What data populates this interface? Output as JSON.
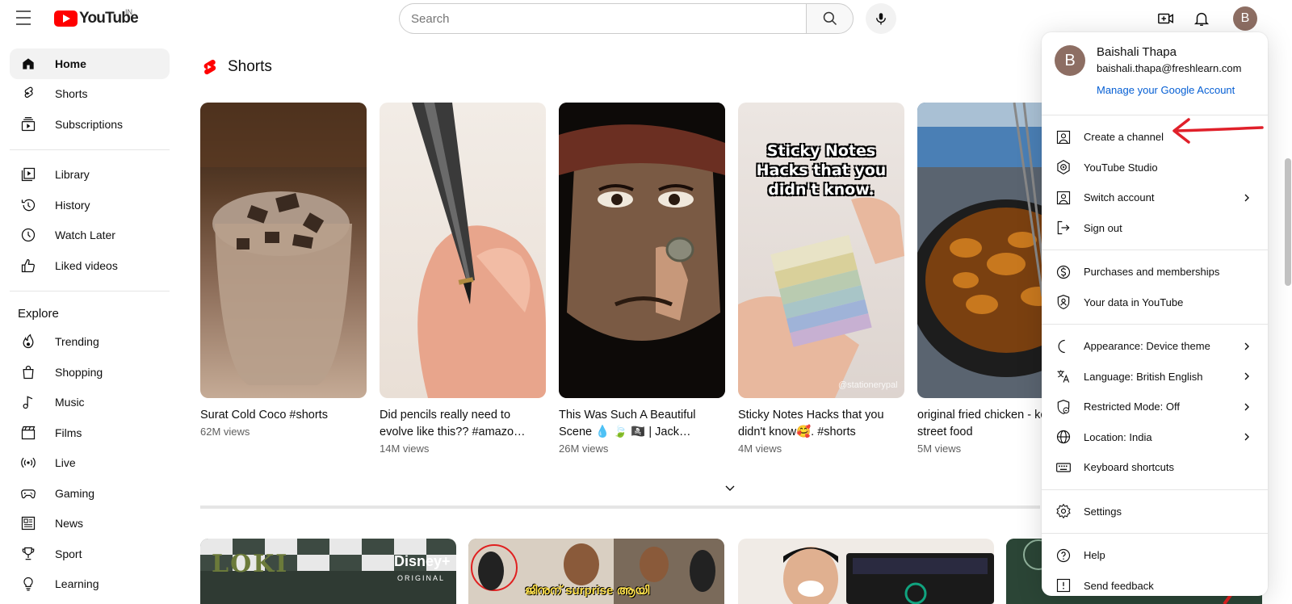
{
  "header": {
    "logo_text": "YouTube",
    "country_code": "IN",
    "search_placeholder": "Search"
  },
  "sidebar": {
    "primary": [
      {
        "label": "Home",
        "icon": "home-icon",
        "active": true
      },
      {
        "label": "Shorts",
        "icon": "shorts-icon"
      },
      {
        "label": "Subscriptions",
        "icon": "subscriptions-icon"
      }
    ],
    "library": [
      {
        "label": "Library",
        "icon": "library-icon"
      },
      {
        "label": "History",
        "icon": "history-icon"
      },
      {
        "label": "Watch Later",
        "icon": "watch-later-icon"
      },
      {
        "label": "Liked videos",
        "icon": "liked-videos-icon"
      }
    ],
    "explore_heading": "Explore",
    "explore": [
      {
        "label": "Trending",
        "icon": "trending-icon"
      },
      {
        "label": "Shopping",
        "icon": "shopping-icon"
      },
      {
        "label": "Music",
        "icon": "music-icon"
      },
      {
        "label": "Films",
        "icon": "films-icon"
      },
      {
        "label": "Live",
        "icon": "live-icon"
      },
      {
        "label": "Gaming",
        "icon": "gaming-icon"
      },
      {
        "label": "News",
        "icon": "news-icon"
      },
      {
        "label": "Sport",
        "icon": "sport-icon"
      },
      {
        "label": "Learning",
        "icon": "learning-icon"
      }
    ]
  },
  "shorts": {
    "heading": "Shorts",
    "items": [
      {
        "title": "Surat Cold Coco #shorts",
        "views": "62M views"
      },
      {
        "title": "Did pencils really need to evolve like this?? #amazo…",
        "views": "14M views"
      },
      {
        "title": "This Was Such A Beautiful Scene 💧 🍃 🏴‍☠️ | Jack…",
        "views": "26M views"
      },
      {
        "title": "Sticky Notes Hacks that you didn't know🥰. #shorts",
        "views": "4M views"
      },
      {
        "title": "original fried chicken - korean street food",
        "views": "5M views"
      }
    ],
    "thumb_texts": {
      "sticky": "Sticky Notes Hacks that you didn't know.",
      "sticky_watermark": "@stationerypal"
    }
  },
  "videos": {
    "thumb_texts": {
      "loki": "LOKI",
      "disney": "Disney+",
      "disney_sub": "ORIGINAL",
      "malayalam": "ജിനുന് surprise ആയി"
    }
  },
  "account_menu": {
    "avatar_letter": "B",
    "name": "Baishali Thapa",
    "email": "baishali.thapa@freshlearn.com",
    "manage_link": "Manage your Google Account",
    "sections": [
      [
        {
          "label": "Create a channel",
          "icon": "create-channel-icon",
          "chevron": false
        },
        {
          "label": "YouTube Studio",
          "icon": "youtube-studio-icon",
          "chevron": false
        },
        {
          "label": "Switch account",
          "icon": "switch-account-icon",
          "chevron": true
        },
        {
          "label": "Sign out",
          "icon": "sign-out-icon",
          "chevron": false
        }
      ],
      [
        {
          "label": "Purchases and memberships",
          "icon": "purchases-icon",
          "chevron": false
        },
        {
          "label": "Your data in YouTube",
          "icon": "data-shield-icon",
          "chevron": false
        }
      ],
      [
        {
          "label": "Appearance: Device theme",
          "icon": "appearance-icon",
          "chevron": true
        },
        {
          "label": "Language: British English",
          "icon": "language-icon",
          "chevron": true
        },
        {
          "label": "Restricted Mode: Off",
          "icon": "restricted-mode-icon",
          "chevron": true
        },
        {
          "label": "Location: India",
          "icon": "globe-icon",
          "chevron": true
        },
        {
          "label": "Keyboard shortcuts",
          "icon": "keyboard-icon",
          "chevron": false
        }
      ],
      [
        {
          "label": "Settings",
          "icon": "settings-icon",
          "chevron": false
        }
      ],
      [
        {
          "label": "Help",
          "icon": "help-icon",
          "chevron": false
        },
        {
          "label": "Send feedback",
          "icon": "feedback-icon",
          "chevron": false
        }
      ]
    ]
  },
  "colors": {
    "brand_red": "#ff0000",
    "link_blue": "#065fd4",
    "avatar_bg": "#8d6e63",
    "annotation_red": "#e0202a"
  }
}
